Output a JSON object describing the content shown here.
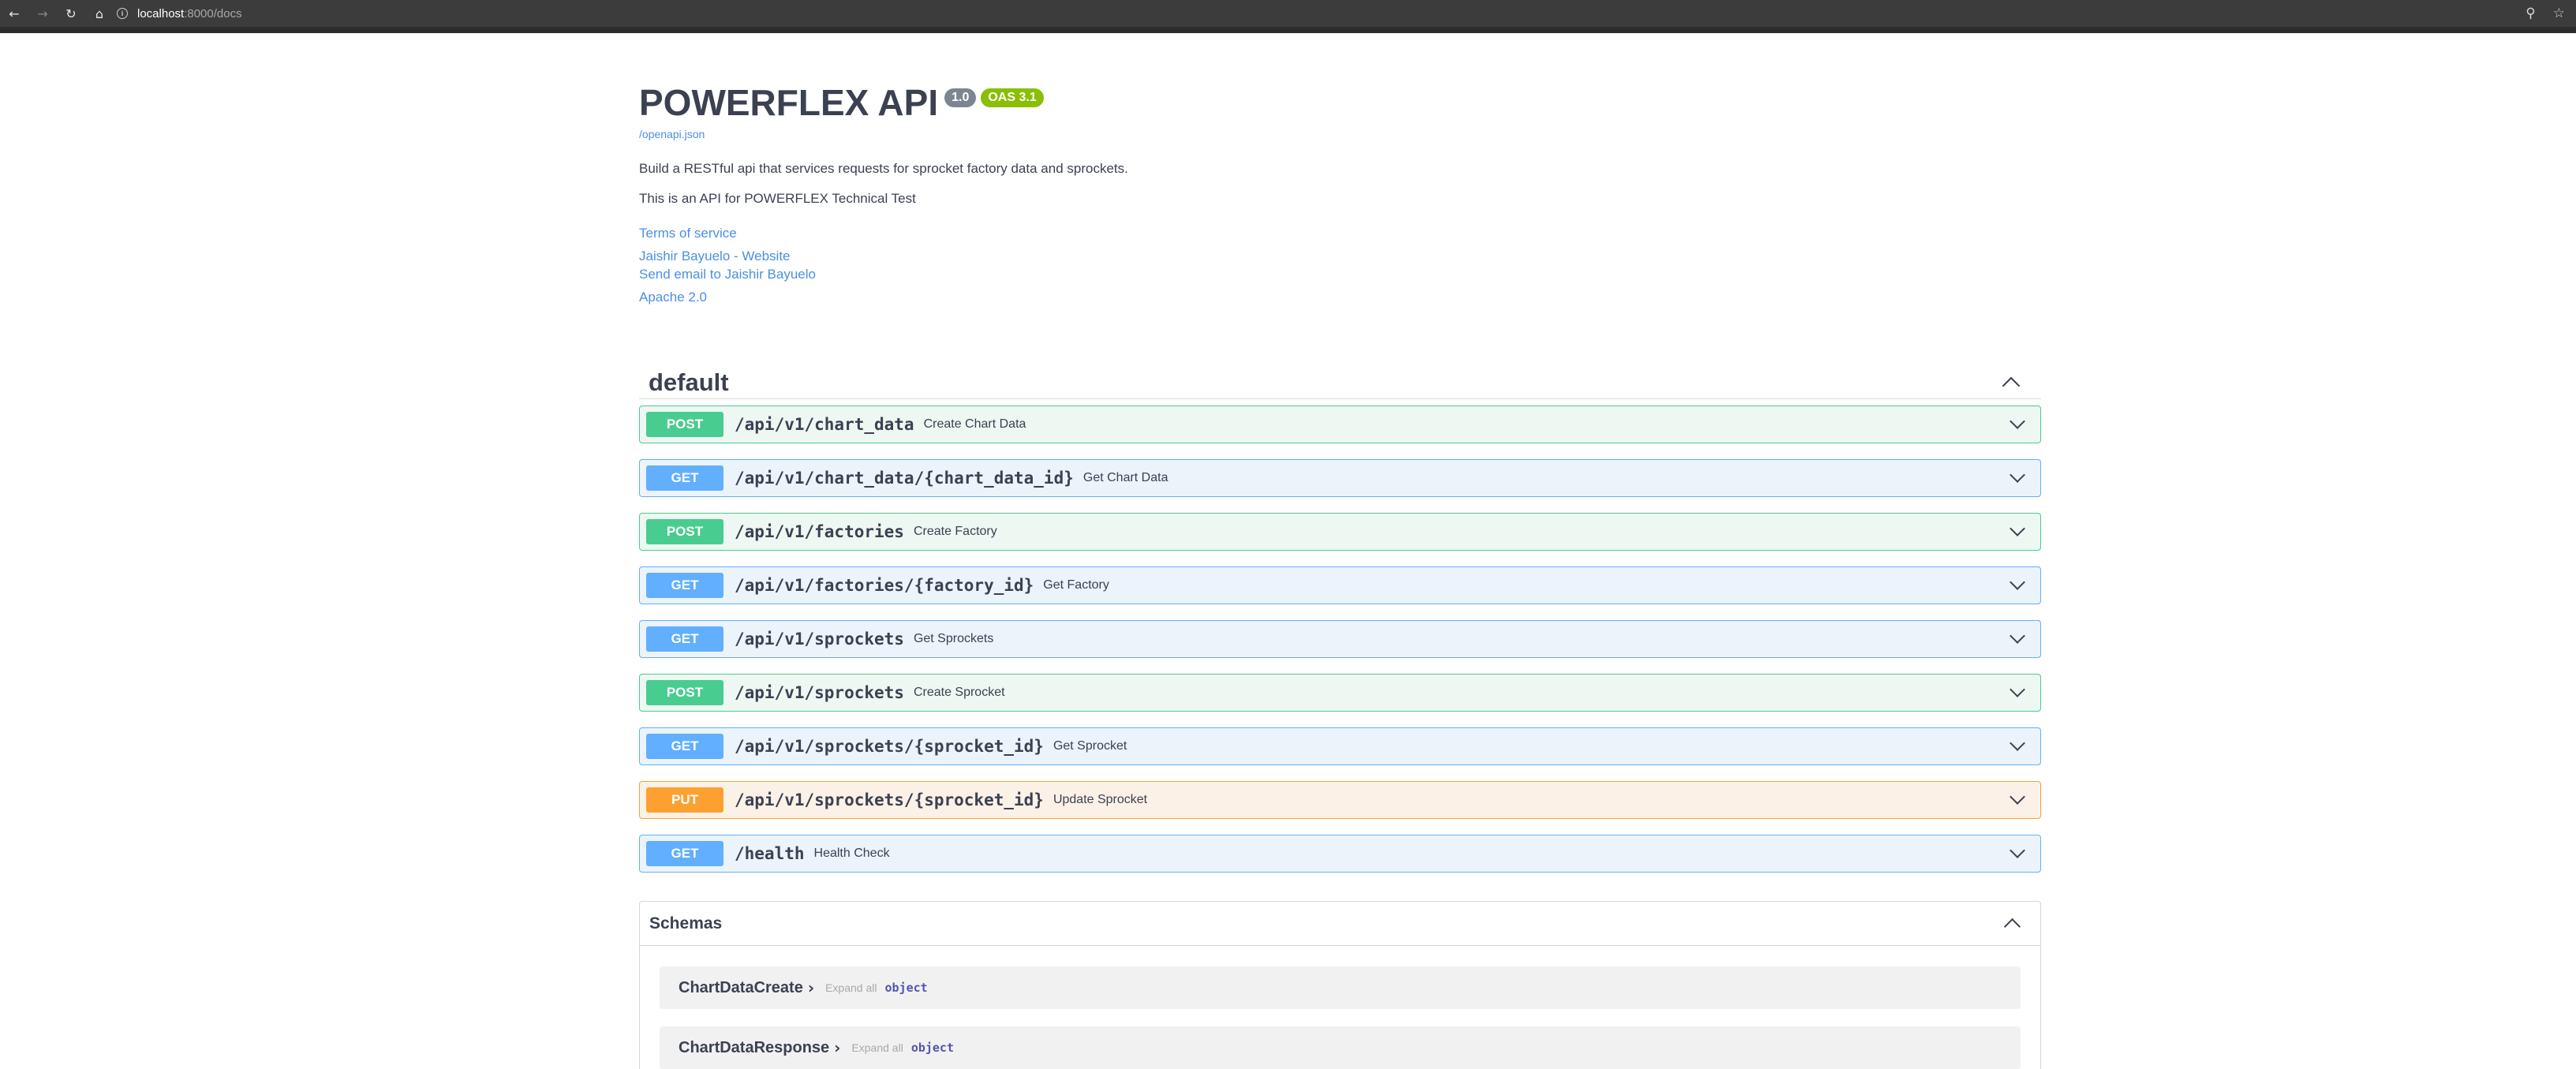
{
  "browser": {
    "back_icon": "arrow-left-icon",
    "forward_icon": "arrow-right-icon",
    "reload_icon": "reload-icon",
    "home_icon": "home-icon",
    "url_host": "localhost",
    "url_rest": ":8000/docs",
    "zoom_icon": "zoom-icon",
    "bookmark_icon": "star-icon"
  },
  "info": {
    "title": "POWERFLEX API",
    "version": "1.0",
    "oas": "OAS 3.1",
    "spec_link": "/openapi.json",
    "description": "Build a RESTful api that services requests for sprocket factory data and sprockets.",
    "description2": "This is an API for POWERFLEX Technical Test",
    "terms": "Terms of service",
    "contact_website": "Jaishir Bayuelo - Website",
    "contact_email": "Send email to Jaishir Bayuelo",
    "license": "Apache 2.0"
  },
  "tag": {
    "name": "default"
  },
  "operations": [
    {
      "method": "POST",
      "path": "/api/v1/chart_data",
      "summary": "Create Chart Data"
    },
    {
      "method": "GET",
      "path": "/api/v1/chart_data/{chart_data_id}",
      "summary": "Get Chart Data"
    },
    {
      "method": "POST",
      "path": "/api/v1/factories",
      "summary": "Create Factory"
    },
    {
      "method": "GET",
      "path": "/api/v1/factories/{factory_id}",
      "summary": "Get Factory"
    },
    {
      "method": "GET",
      "path": "/api/v1/sprockets",
      "summary": "Get Sprockets"
    },
    {
      "method": "POST",
      "path": "/api/v1/sprockets",
      "summary": "Create Sprocket"
    },
    {
      "method": "GET",
      "path": "/api/v1/sprockets/{sprocket_id}",
      "summary": "Get Sprocket"
    },
    {
      "method": "PUT",
      "path": "/api/v1/sprockets/{sprocket_id}",
      "summary": "Update Sprocket"
    },
    {
      "method": "GET",
      "path": "/health",
      "summary": "Health Check"
    }
  ],
  "schemas": {
    "title": "Schemas",
    "models": [
      {
        "name": "ChartDataCreate",
        "expand": "Expand all",
        "type": "object"
      },
      {
        "name": "ChartDataResponse",
        "expand": "Expand all",
        "type": "object"
      }
    ]
  },
  "colors": {
    "post": "#49cc90",
    "get": "#61affe",
    "put": "#fca130",
    "link": "#4990e2",
    "oas_badge": "#89bf04"
  }
}
